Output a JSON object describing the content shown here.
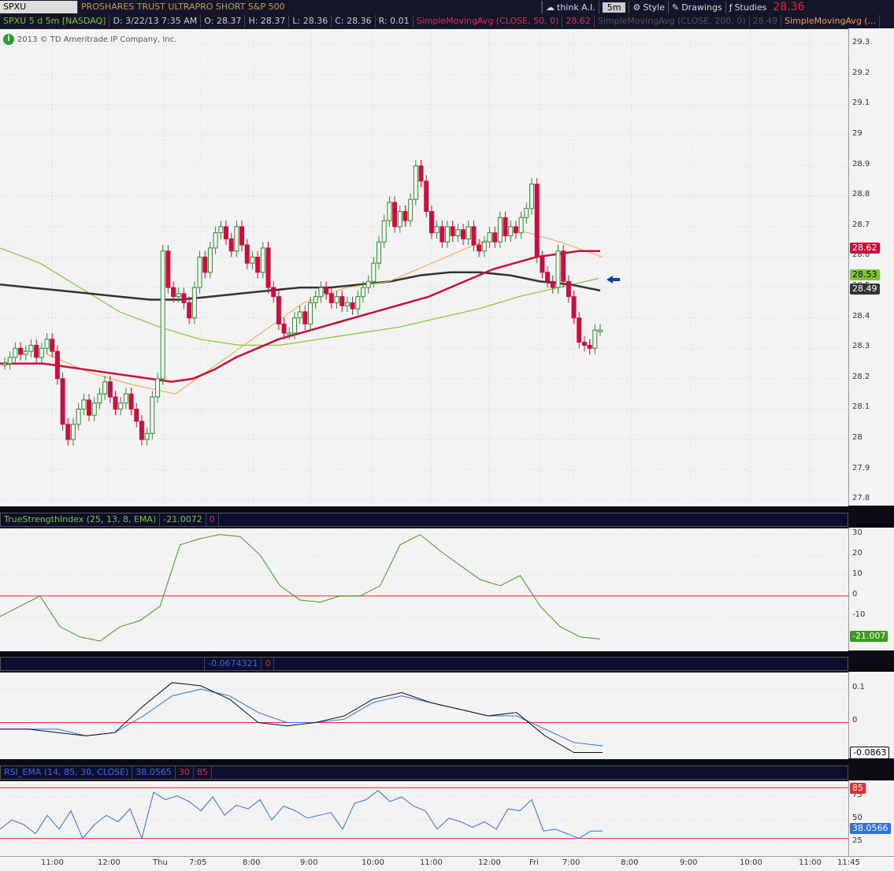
{
  "header": {
    "symbol": "SPXU",
    "name": "PROSHARES TRUST ULTRAPRO SHORT S&P 500",
    "last": "28.36",
    "think": "think A.I.",
    "interval": "5m",
    "style": "Style",
    "drawings": "Drawings",
    "studies": "Studies"
  },
  "infobar": {
    "desc": "SPXU 5 d 5m [NASDAQ]",
    "date": "D: 3/22/13 7:35 AM",
    "open": "O: 28.37",
    "high": "H: 28.37",
    "low": "L: 28.36",
    "close": "C: 28.36",
    "range": "R: 0.01",
    "sma50": "SimpleMovingAvg (CLOSE, 50, 0)",
    "sma50v": "28.62",
    "sma200": "SimpleMovingAvg (CLOSE, 200, 0)",
    "sma200v": "28.49",
    "sma3": "SimpleMovingAvg (..."
  },
  "copyright": "2013 © TD Ameritrade IP Company, Inc.",
  "colors": {
    "up": "#2e8b2e",
    "down": "#c8103e",
    "sma50": "#c8103e",
    "sma200": "#333333",
    "green_ma": "#7dc832",
    "orange_ma": "#f5a040"
  },
  "tags": {
    "sma50": "28.62",
    "green": "28.53",
    "sma200": "28.49",
    "tsi": "-21.007",
    "p3": "-0.0863",
    "rsi": "38.0566",
    "rsi_hi": "85"
  },
  "panels": {
    "tsi": {
      "label": "TrueStrengthIndex (25, 13, 8, EMA)",
      "value": "-21.0072",
      "zero": "0"
    },
    "p3": {
      "value": "-0.0674321",
      "zero": "0"
    },
    "rsi": {
      "label": "RSI_EMA (14, 85, 30, CLOSE)",
      "value": "38.0565",
      "lo": "30",
      "hi": "85"
    }
  },
  "chart_data": {
    "type": "candlestick",
    "price_ticks": [
      "29.3",
      "29.2",
      "29.1",
      "29",
      "28.9",
      "28.8",
      "28.7",
      "28.6",
      "28.5",
      "28.4",
      "28.3",
      "28.2",
      "28.1",
      "28",
      "27.9",
      "27.8"
    ],
    "ylim": [
      27.78,
      29.35
    ],
    "tsi_ticks": [
      "30",
      "20",
      "10",
      "0",
      "-10"
    ],
    "p3_ticks": [
      "0.1",
      "0"
    ],
    "rsi_ticks": [
      "75",
      "50",
      "25"
    ],
    "x_ticks": [
      "11:00",
      "12:00",
      "Thu",
      "7:05",
      "8:00",
      "9:00",
      "10:00",
      "11:00",
      "12:00",
      "Fri",
      "7:00",
      "8:00",
      "9:00",
      "10:00",
      "11:00",
      "11:45"
    ],
    "closes": [
      28.25,
      28.27,
      28.3,
      28.28,
      28.29,
      28.31,
      28.27,
      28.3,
      28.33,
      28.29,
      28.2,
      28.05,
      28.0,
      28.05,
      28.1,
      28.13,
      28.08,
      28.12,
      28.15,
      28.19,
      28.14,
      28.1,
      28.12,
      28.15,
      28.1,
      28.06,
      28.0,
      28.02,
      28.14,
      28.2,
      28.62,
      28.5,
      28.47,
      28.48,
      28.45,
      28.4,
      28.5,
      28.6,
      28.55,
      28.63,
      28.68,
      28.7,
      28.66,
      28.62,
      28.7,
      28.64,
      28.58,
      28.6,
      28.55,
      28.63,
      28.5,
      28.47,
      28.38,
      28.35,
      28.35,
      28.4,
      28.42,
      28.38,
      28.45,
      28.47,
      28.5,
      28.48,
      28.45,
      28.47,
      28.44,
      28.45,
      28.43,
      28.47,
      28.5,
      28.52,
      28.58,
      28.65,
      28.72,
      28.78,
      28.7,
      28.75,
      28.72,
      28.79,
      28.9,
      28.85,
      28.75,
      28.68,
      28.7,
      28.65,
      28.7,
      28.67,
      28.69,
      28.66,
      28.7,
      28.64,
      28.62,
      28.65,
      28.68,
      28.65,
      28.73,
      28.67,
      28.7,
      28.68,
      28.73,
      28.76,
      28.84,
      28.6,
      28.55,
      28.52,
      28.5,
      28.62,
      28.52,
      28.47,
      28.4,
      28.32,
      28.31,
      28.3,
      28.36,
      28.36
    ],
    "sma50": [
      28.25,
      28.25,
      28.25,
      28.24,
      28.23,
      28.22,
      28.21,
      28.2,
      28.19,
      28.2,
      28.23,
      28.27,
      28.3,
      28.33,
      28.35,
      28.37,
      28.39,
      28.41,
      28.43,
      28.45,
      28.47,
      28.5,
      28.53,
      28.56,
      28.58,
      28.6,
      28.61,
      28.62,
      28.62
    ],
    "sma200": [
      28.51,
      28.5,
      28.49,
      28.48,
      28.47,
      28.46,
      28.46,
      28.47,
      28.48,
      28.49,
      28.5,
      28.5,
      28.51,
      28.52,
      28.54,
      28.55,
      28.55,
      28.54,
      28.52,
      28.51,
      28.49
    ],
    "green_ma": [
      28.63,
      28.58,
      28.5,
      28.42,
      28.37,
      28.33,
      28.31,
      28.31,
      28.33,
      28.35,
      28.37,
      28.4,
      28.43,
      28.47,
      28.5,
      28.53
    ],
    "orange_ma": [
      28.28,
      28.22,
      28.18,
      28.15,
      28.25,
      28.35,
      28.45,
      28.5,
      28.52,
      28.58,
      28.64,
      28.69,
      28.65,
      28.6
    ],
    "tsi": [
      -10,
      -5,
      0,
      -15,
      -20,
      -22,
      -15,
      -12,
      -5,
      25,
      28,
      30,
      29,
      20,
      5,
      -2,
      -3,
      0,
      0,
      5,
      25,
      30,
      22,
      15,
      8,
      5,
      10,
      -5,
      -15,
      -20,
      -21
    ],
    "p3_black": [
      -0.02,
      -0.02,
      -0.03,
      -0.04,
      -0.03,
      0.05,
      0.12,
      0.11,
      0.07,
      0.0,
      -0.01,
      0.0,
      0.02,
      0.07,
      0.09,
      0.06,
      0.04,
      0.02,
      0.03,
      -0.04,
      -0.09,
      -0.09
    ],
    "p3_blue": [
      -0.02,
      -0.02,
      -0.02,
      -0.04,
      -0.03,
      0.02,
      0.08,
      0.1,
      0.08,
      0.03,
      0.0,
      0.0,
      0.01,
      0.06,
      0.08,
      0.06,
      0.04,
      0.02,
      0.02,
      -0.02,
      -0.06,
      -0.07
    ],
    "rsi": [
      40,
      50,
      45,
      35,
      55,
      40,
      60,
      30,
      45,
      55,
      48,
      62,
      30,
      80,
      72,
      76,
      70,
      60,
      75,
      55,
      66,
      62,
      72,
      50,
      65,
      60,
      52,
      55,
      58,
      40,
      68,
      72,
      82,
      70,
      75,
      65,
      60,
      40,
      52,
      48,
      42,
      48,
      40,
      62,
      60,
      72,
      38,
      40,
      35,
      30,
      38,
      38
    ]
  }
}
